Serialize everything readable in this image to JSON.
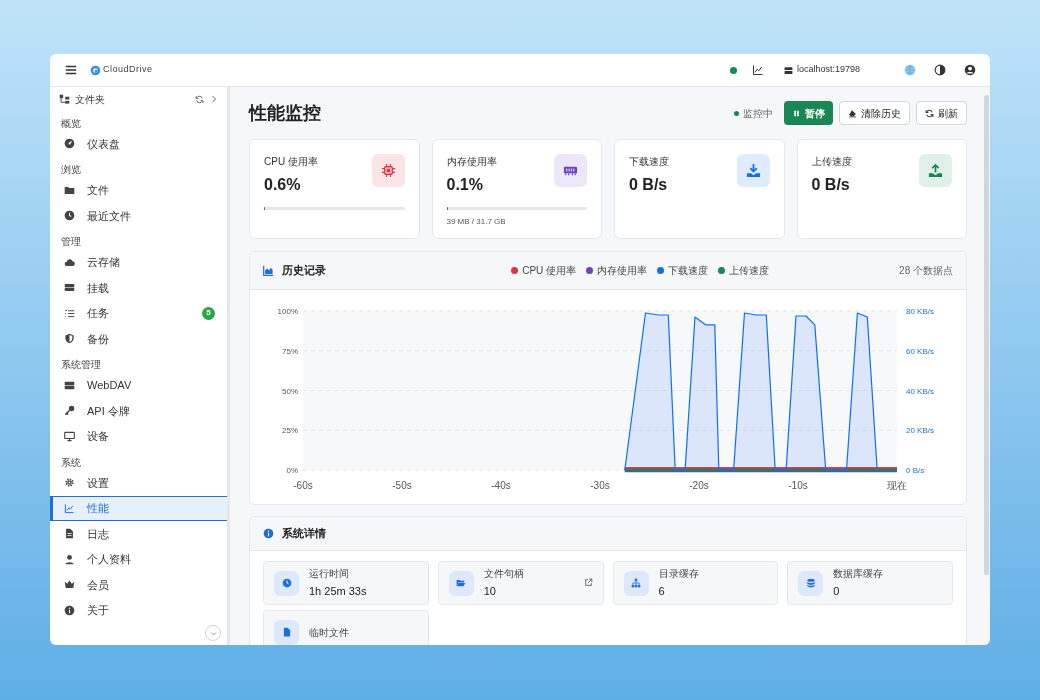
{
  "topbar": {
    "brand": "CloudDrive",
    "connection_on": true,
    "server": "localhost:19798"
  },
  "sidebar": {
    "folder_label": "文件夹",
    "sections": [
      {
        "title": "概览",
        "items": [
          {
            "label": "仪表盘",
            "selected": false
          }
        ]
      },
      {
        "title": "浏览",
        "items": [
          {
            "label": "文件",
            "selected": false
          },
          {
            "label": "最近文件",
            "selected": false
          }
        ]
      },
      {
        "title": "管理",
        "items": [
          {
            "label": "云存储",
            "selected": false
          },
          {
            "label": "挂载",
            "selected": false
          },
          {
            "label": "任务",
            "selected": false,
            "badge": "5"
          },
          {
            "label": "备份",
            "selected": false
          }
        ]
      },
      {
        "title": "系统管理",
        "items": [
          {
            "label": "WebDAV",
            "selected": false
          },
          {
            "label": "API 令牌",
            "selected": false
          },
          {
            "label": "设备",
            "selected": false
          }
        ]
      },
      {
        "title": "系统",
        "items": [
          {
            "label": "设置",
            "selected": false
          },
          {
            "label": "性能",
            "selected": true
          },
          {
            "label": "日志",
            "selected": false
          },
          {
            "label": "个人资料",
            "selected": false
          },
          {
            "label": "会员",
            "selected": false
          },
          {
            "label": "关于",
            "selected": false
          }
        ]
      }
    ]
  },
  "page": {
    "title": "性能监控",
    "monitoring": {
      "label": "监控中",
      "on": true
    },
    "buttons": [
      {
        "label": "暂停",
        "kind": "primary"
      },
      {
        "label": "清除历史",
        "kind": "outline"
      },
      {
        "label": "刷新",
        "kind": "outline"
      }
    ]
  },
  "stats": [
    {
      "label": "CPU 使用率",
      "value": "0.6%",
      "level": 0.006,
      "color": "#dc3545"
    },
    {
      "label": "内存使用率",
      "value": "0.1%",
      "level": 0.003,
      "detail": "39 MB / 31.7 GB",
      "color": "#6f42c1"
    },
    {
      "label": "下载速度",
      "value": "0 B/s",
      "color": "#0d6efd"
    },
    {
      "label": "上传速度",
      "value": "0 B/s",
      "color": "#198754"
    }
  ],
  "history": {
    "title": "历史记录",
    "points": "28 个数据点",
    "chart_data": {
      "type": "line",
      "xticks": [
        {
          "value": -60,
          "label": "-60s"
        },
        {
          "value": -50,
          "label": "-50s"
        },
        {
          "value": -40,
          "label": "-40s"
        },
        {
          "value": -30,
          "label": "-30s"
        },
        {
          "value": -20,
          "label": "-20s"
        },
        {
          "value": -10,
          "label": "-10s"
        },
        {
          "value": 0,
          "label": "现在"
        }
      ],
      "grid": true,
      "xlim": [
        -60,
        0
      ],
      "ylim": [
        0,
        100
      ],
      "y2lim": [
        0,
        80
      ],
      "yticks": [
        {
          "value": 0,
          "label": "0%"
        },
        {
          "value": 25,
          "label": "25%"
        },
        {
          "value": 50,
          "label": "50%"
        },
        {
          "value": 75,
          "label": "75%"
        },
        {
          "value": 100,
          "label": "100%"
        }
      ],
      "y2ticks": [
        {
          "value": 0,
          "label": "0 B/s"
        },
        {
          "value": 20,
          "label": "20 KB/s"
        },
        {
          "value": 40,
          "label": "40 KB/s"
        },
        {
          "value": 60,
          "label": "60 KB/s"
        },
        {
          "value": 80,
          "label": "80 KB/s"
        }
      ],
      "x": [
        -27.5,
        -25.4,
        -24.1,
        -23.1,
        -22.4,
        -21.4,
        -20.4,
        -19.3,
        -18.4,
        -18,
        -16.5,
        -15.4,
        -14.2,
        -13.2,
        -12.3,
        -11.2,
        -10.2,
        -9.2,
        -8.3,
        -7.2,
        -5.1,
        -4,
        -3,
        -2,
        0
      ],
      "series": [
        {
          "name": "CPU 使用率",
          "color": "#dc3545",
          "values": [
            0.6,
            0.6,
            0.6,
            0.6,
            0.6,
            0.6,
            0.6,
            0.6,
            0.6,
            0.6,
            0.6,
            0.6,
            0.6,
            0.6,
            0.6,
            0.6,
            0.6,
            0.6,
            0.6,
            0.6,
            0.6,
            0.6,
            0.6,
            0.6,
            0.6
          ]
        },
        {
          "name": "内存使用率",
          "color": "#6f42c1",
          "values": [
            0.1,
            0.1,
            0.1,
            0.1,
            0.1,
            0.1,
            0.1,
            0.1,
            0.1,
            0.1,
            0.1,
            0.1,
            0.1,
            0.1,
            0.1,
            0.1,
            0.1,
            0.1,
            0.1,
            0.1,
            0.1,
            0.1,
            0.1,
            0.1,
            0.1
          ]
        },
        {
          "name": "下载速度",
          "color": "#0d6efd",
          "axis": "y2",
          "values": [
            0,
            79,
            78,
            78,
            0,
            0,
            77,
            73,
            73,
            0,
            0,
            79,
            78,
            78,
            0,
            0,
            77.5,
            77.5,
            73,
            0,
            0,
            79,
            77,
            0,
            null
          ]
        },
        {
          "name": "上传速度",
          "color": "#198754",
          "axis": "y2",
          "values": [
            0,
            0,
            0,
            0,
            0,
            0,
            0,
            0,
            0,
            0,
            0,
            0,
            0,
            0,
            0,
            0,
            0,
            0,
            0,
            0,
            0,
            0,
            0,
            0,
            0
          ]
        }
      ]
    }
  },
  "details": {
    "title": "系统详情",
    "items": [
      {
        "label": "运行时间",
        "value": "1h 25m 33s"
      },
      {
        "label": "文件句柄",
        "value": "10",
        "link": true
      },
      {
        "label": "目录缓存",
        "value": "6"
      },
      {
        "label": "数据库缓存",
        "value": "0"
      },
      {
        "label": "临时文件"
      }
    ]
  }
}
